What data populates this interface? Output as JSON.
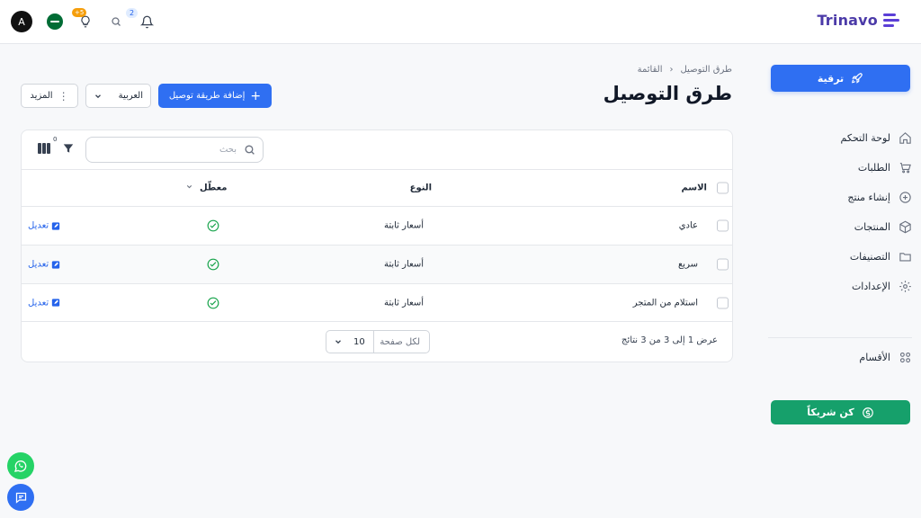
{
  "brand": {
    "name": "Trinavo"
  },
  "header": {
    "avatar_letter": "A",
    "tips_badge": "+5",
    "notifications_badge": "2"
  },
  "sidebar": {
    "upgrade_label": "ترقية",
    "nav_items": [
      {
        "label": "لوحة التحكم",
        "icon": "home-icon"
      },
      {
        "label": "الطلبات",
        "icon": "cart-icon"
      },
      {
        "label": "إنشاء منتج",
        "icon": "plus-circle-icon"
      },
      {
        "label": "المنتجات",
        "icon": "box-icon"
      },
      {
        "label": "التصنيفات",
        "icon": "folder-icon"
      },
      {
        "label": "الإعدادات",
        "icon": "gear-icon"
      }
    ],
    "sections_label": "الأقسام",
    "partner_label": "كن شريكاً"
  },
  "breadcrumb": {
    "current": "طرق التوصيل",
    "parent": "القائمة"
  },
  "page_title": "طرق التوصيل",
  "actions": {
    "add_label": "إضافة طريقة توصيل",
    "language_value": "العربية",
    "more_label": "المزيد"
  },
  "toolbar": {
    "search_placeholder": "بحث",
    "filter_count": "0"
  },
  "table": {
    "columns": {
      "name": "الاسم",
      "type": "النوع",
      "disabled": "معطّل"
    },
    "rows": [
      {
        "name": "عادي",
        "type": "أسعار ثابتة",
        "edit": "تعديل"
      },
      {
        "name": "سريع",
        "type": "أسعار ثابتة",
        "edit": "تعديل"
      },
      {
        "name": "استلام من المتجر",
        "type": "أسعار ثابتة",
        "edit": "تعديل"
      }
    ]
  },
  "pagination": {
    "per_page_label": "لكل صفحة",
    "per_page_value": "10",
    "summary": "عرض 1 إلى 3 من 3 نتائج"
  },
  "colors": {
    "primary": "#2f6ff2",
    "success": "#16a06b",
    "brand": "#4b3aa8"
  }
}
